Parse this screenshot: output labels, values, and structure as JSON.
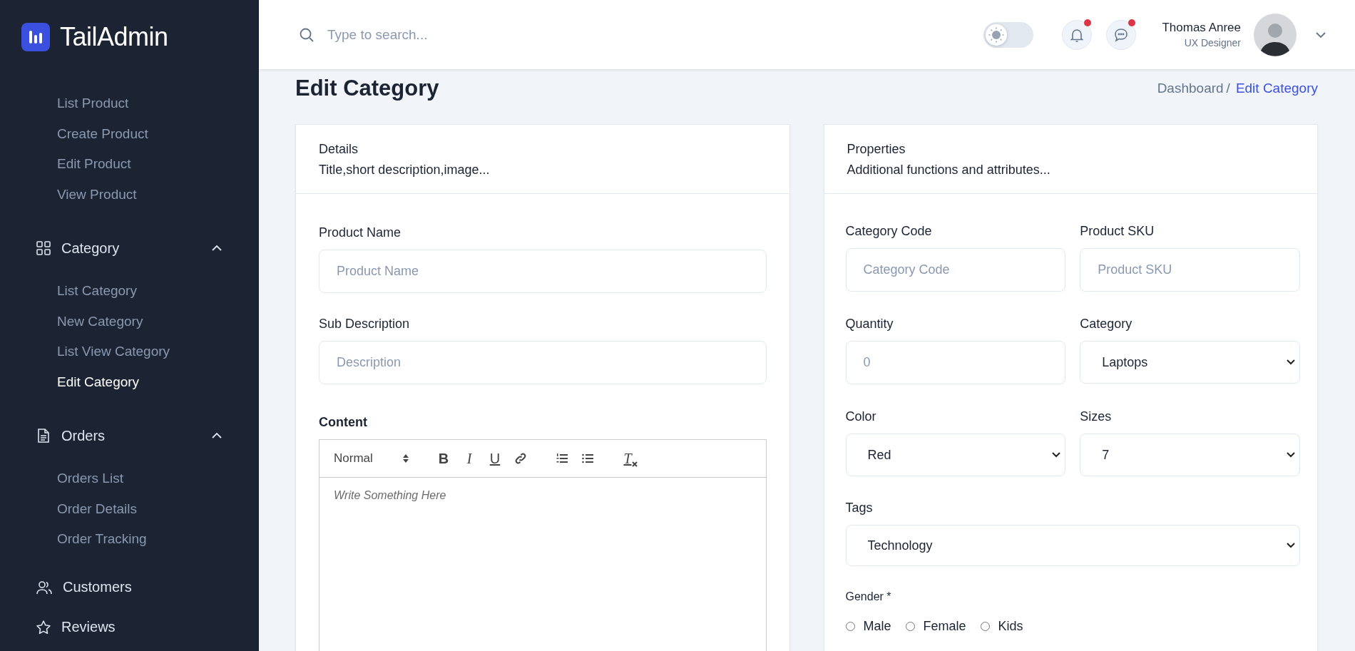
{
  "brand": {
    "name": "TailAdmin"
  },
  "sidebar": {
    "items": [
      {
        "kind": "sublist",
        "children": [
          {
            "label": "List Product",
            "selected": false
          },
          {
            "label": "Create Product",
            "selected": false
          },
          {
            "label": "Edit Product",
            "selected": false
          },
          {
            "label": "View Product",
            "selected": false
          }
        ]
      },
      {
        "kind": "group",
        "label": "Category",
        "expanded": true,
        "children": [
          {
            "label": "List Category",
            "selected": false
          },
          {
            "label": "New Category",
            "selected": false
          },
          {
            "label": "List View Category",
            "selected": false
          },
          {
            "label": "Edit Category",
            "selected": true
          }
        ]
      },
      {
        "kind": "group",
        "label": "Orders",
        "expanded": true,
        "children": [
          {
            "label": "Orders List",
            "selected": false
          },
          {
            "label": "Order Details",
            "selected": false
          },
          {
            "label": "Order Tracking",
            "selected": false
          }
        ]
      },
      {
        "kind": "link",
        "label": "Customers"
      },
      {
        "kind": "link",
        "label": "Reviews"
      }
    ]
  },
  "header": {
    "search": {
      "placeholder": "Type to search..."
    },
    "dark_mode": {
      "on": false
    },
    "notifications": {
      "unread": true
    },
    "messages": {
      "unread": true
    },
    "user": {
      "name": "Thomas Anree",
      "role": "UX Designer"
    }
  },
  "page": {
    "title": "Edit Category",
    "breadcrumb": [
      {
        "label": "Dashboard",
        "current": false
      },
      {
        "label": "Edit Category",
        "current": true
      }
    ],
    "separator": "/"
  },
  "details_card": {
    "title": "Details",
    "subtitle": "Title,short description,image...",
    "fields": [
      {
        "label": "Product Name",
        "placeholder": "Product Name"
      },
      {
        "label": "Sub Description",
        "placeholder": "Description"
      }
    ],
    "editor": {
      "label": "Content",
      "format": "Normal",
      "placeholder": "Write Something Here",
      "tools": [
        {
          "kind": "bold",
          "label": "B"
        },
        {
          "kind": "italic",
          "label": "I"
        },
        {
          "kind": "underline",
          "label": "U"
        },
        {
          "kind": "link"
        },
        {
          "kind": "ordered-list"
        },
        {
          "kind": "bullet-list"
        },
        {
          "kind": "clean",
          "label": "T"
        }
      ]
    }
  },
  "properties_card": {
    "title": "Properties",
    "subtitle": "Additional functions and attributes...",
    "fields": [
      {
        "kind": "input",
        "label": "Category Code",
        "placeholder": "Category Code"
      },
      {
        "kind": "input",
        "label": "Product SKU",
        "placeholder": "Product SKU"
      },
      {
        "kind": "input",
        "label": "Quantity",
        "placeholder": "0"
      },
      {
        "kind": "select",
        "label": "Category",
        "value": "Laptops"
      },
      {
        "kind": "select",
        "label": "Color",
        "value": "Red"
      },
      {
        "kind": "select",
        "label": "Sizes",
        "value": "7"
      }
    ],
    "tags": {
      "label": "Tags",
      "value": "Technology"
    },
    "gender": {
      "label": "Gender *",
      "options": [
        {
          "label": "Male",
          "selected": false
        },
        {
          "label": "Female",
          "selected": false
        },
        {
          "label": "Kids",
          "selected": false
        }
      ]
    }
  }
}
